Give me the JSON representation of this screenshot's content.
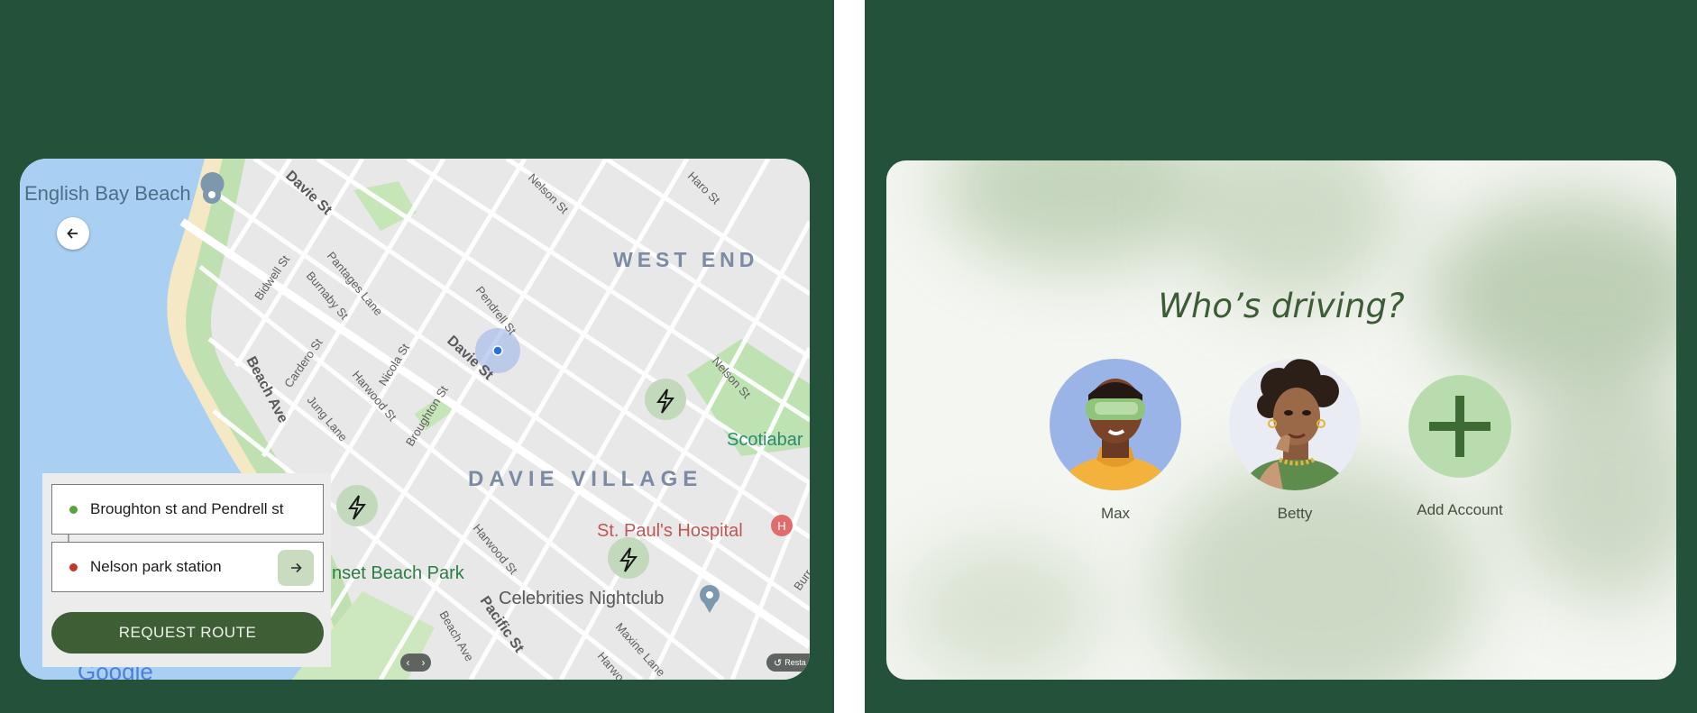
{
  "map_screen": {
    "labels": {
      "english_bay": "English Bay Beach",
      "west_end": "WEST END",
      "davie_village": "DAVIE VILLAGE",
      "st_pauls": "St. Paul's Hospital",
      "scotiabank": "Scotiabar",
      "sunset_beach": "nset Beach Park",
      "celebrities": "Celebrities Nightclub",
      "davie_st_1": "Davie St",
      "davie_st_2": "Davie St",
      "beach_ave": "Beach Ave",
      "beach_ave_2": "Beach Ave",
      "pacific_st": "Pacific St",
      "nelson_st_1": "Nelson St",
      "nelson_st_2": "Nelson St",
      "pendrell_st": "Pendrell St",
      "broughton_st": "Broughton St",
      "nicola_st": "Nicola St",
      "harwood_st_1": "Harwood St",
      "harwood_st_2": "Harwood St",
      "cardero_st": "Cardero St",
      "jung_lane": "Jung Lane",
      "bidwell_st": "Bidwell St",
      "burnaby_st": "Burnaby St",
      "pantages_lane": "Pantages Lane",
      "haro_st": "Haro St",
      "maxine_lane": "Maxine Lane",
      "harwo": "Harwo",
      "burr": "Burr",
      "google": "Google"
    },
    "route": {
      "origin": "Broughton st and Pendrell st",
      "destination": "Nelson park station",
      "request_button": "REQUEST  ROUTE"
    },
    "restart_label": "Resta",
    "colors": {
      "origin_dot": "#5ba33b",
      "destination_dot": "#c2372e",
      "button": "#3e5e36"
    }
  },
  "profile_screen": {
    "title": "Who’s driving?",
    "profiles": [
      {
        "name": "Max"
      },
      {
        "name": "Betty"
      }
    ],
    "add_account_label": "Add Account"
  }
}
